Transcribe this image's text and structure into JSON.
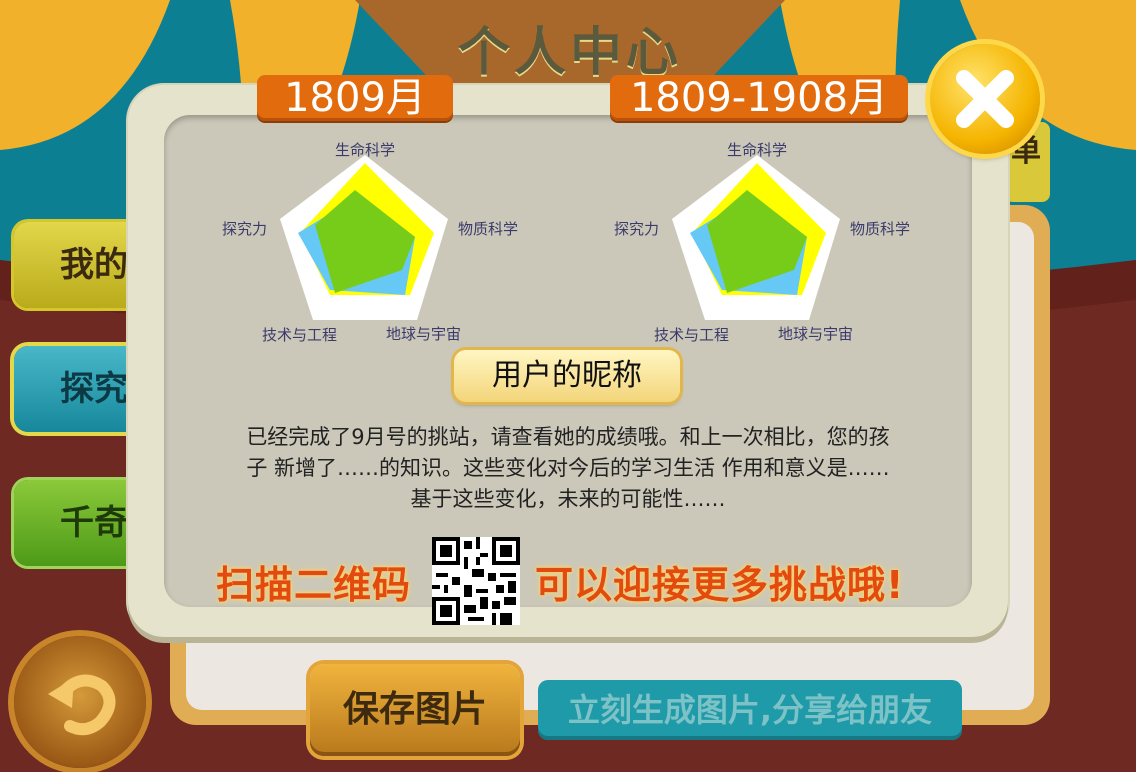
{
  "page_title": "个人中心",
  "side_menu": [
    {
      "label": "我的"
    },
    {
      "label": "探究"
    },
    {
      "label": "千奇"
    }
  ],
  "right_partial_label": "单",
  "dialog": {
    "tab_left": "1809月",
    "tab_right": "1809-1908月",
    "radar_axes": [
      "生命科学",
      "物质科学",
      "地球与宇宙",
      "技术与工程",
      "探究力"
    ],
    "nickname": "用户的昵称",
    "description_lines": [
      "已经完成了9月号的挑站，请查看她的成绩哦。和上一次相比，您的孩",
      "子 新增了……的知识。这些变化对今后的学习生活 作用和意义是……",
      "基于这些变化，未来的可能性……"
    ],
    "scan_text": "扫描二维码",
    "challenge_text": "可以迎接更多挑战哦!"
  },
  "buttons": {
    "save": "保存图片",
    "share": "立刻生成图片,分享给朋友"
  },
  "icons": {
    "close": "close-icon",
    "back": "back-arrow-icon",
    "qr": "qr-code-icon"
  },
  "colors": {
    "tab_orange": "#e26b0e",
    "series_yellow": "#ffff00",
    "series_blue": "#66c8f5",
    "series_green": "#77cc1a",
    "accent_text": "#e24a10"
  }
}
